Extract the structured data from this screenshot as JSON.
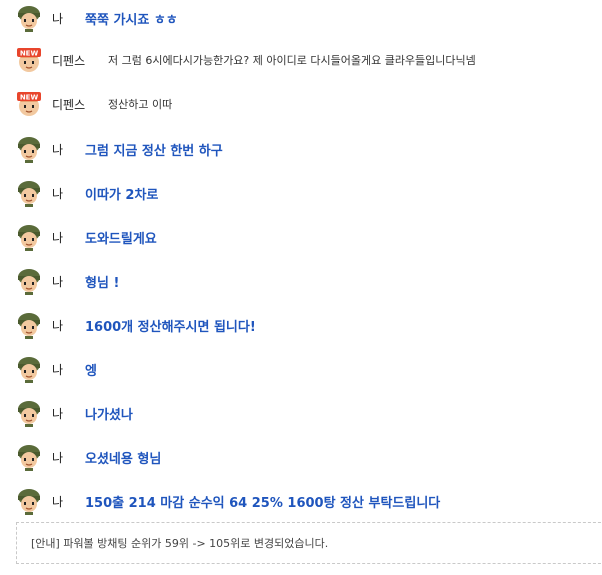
{
  "messages": [
    {
      "sender": "나",
      "text": "쭉쭉 가시죠 ㅎㅎ",
      "type": "me",
      "avatar": "soldier-avatar-icon"
    },
    {
      "sender": "디펜스",
      "text": "저 그럼 6시에다시가능한가요? 제 아이디로 다시들어올게요 클라우들입니다닉넴",
      "type": "other",
      "avatar": "new-user-avatar-icon"
    },
    {
      "sender": "디펜스",
      "text": "정산하고 이따",
      "type": "other",
      "avatar": "new-user-avatar-icon"
    },
    {
      "sender": "나",
      "text": "그럼 지금 정산 한번 하구",
      "type": "me",
      "avatar": "soldier-avatar-icon"
    },
    {
      "sender": "나",
      "text": "이따가 2차로",
      "type": "me",
      "avatar": "soldier-avatar-icon"
    },
    {
      "sender": "나",
      "text": "도와드릴게요",
      "type": "me",
      "avatar": "soldier-avatar-icon"
    },
    {
      "sender": "나",
      "text": "형님 !",
      "type": "me",
      "avatar": "soldier-avatar-icon"
    },
    {
      "sender": "나",
      "text": "1600개 정산해주시면 됩니다!",
      "type": "me",
      "avatar": "soldier-avatar-icon"
    },
    {
      "sender": "나",
      "text": "엥",
      "type": "me",
      "avatar": "soldier-avatar-icon"
    },
    {
      "sender": "나",
      "text": "나가셨나",
      "type": "me",
      "avatar": "soldier-avatar-icon"
    },
    {
      "sender": "나",
      "text": "오셨네용 형님",
      "type": "me",
      "avatar": "soldier-avatar-icon"
    },
    {
      "sender": "나",
      "text": "150출 214 마감 순수익 64 25% 1600탕 정산 부탁드립니다",
      "type": "me",
      "avatar": "soldier-avatar-icon"
    }
  ],
  "notice": "[안내] 파워볼 방채팅 순위가 59위 -> 105위로 변경되었습니다.",
  "badge_text": "NEW",
  "colors": {
    "my_message": "#1f55bd",
    "helmet": "#5a6b3a",
    "badge": "#e8452c"
  }
}
